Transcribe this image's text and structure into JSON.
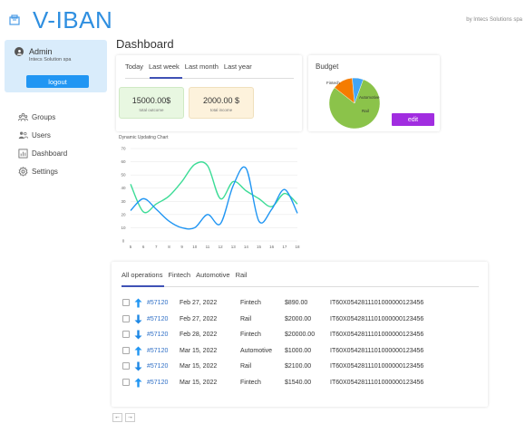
{
  "brand": {
    "name": "V-IBAN",
    "byline": "by Intecs Solutions spa"
  },
  "user": {
    "name": "Admin",
    "company": "Intecs Solution spa",
    "logout_label": "logout"
  },
  "nav": [
    {
      "label": "Groups",
      "icon": "groups-icon"
    },
    {
      "label": "Users",
      "icon": "users-icon"
    },
    {
      "label": "Dashboard",
      "icon": "dashboard-icon"
    },
    {
      "label": "Settings",
      "icon": "gear-icon"
    }
  ],
  "page_title": "Dashboard",
  "period_tabs": [
    "Today",
    "Last week",
    "Last month",
    "Last year"
  ],
  "active_period_tab": "Last week",
  "stats": {
    "outcome": {
      "value": "15000.00$",
      "label": "total outcome"
    },
    "income": {
      "value": "2000.00 $",
      "label": "total income"
    }
  },
  "budget": {
    "title": "Budget",
    "edit_label": "edit",
    "slices": [
      {
        "name": "Fintech",
        "share": 0.8,
        "color": "#8bc34a"
      },
      {
        "name": "Automotive",
        "share": 0.13,
        "color": "#f57c00"
      },
      {
        "name": "Rail",
        "share": 0.07,
        "color": "#42a5f5"
      }
    ]
  },
  "chart_data": {
    "type": "line",
    "title": "Dynamic Updating Chart",
    "x": [
      5,
      6,
      7,
      8,
      9,
      10,
      11,
      12,
      13,
      14,
      15,
      16,
      17,
      18
    ],
    "ylim": [
      0,
      70
    ],
    "yticks": [
      0,
      10,
      20,
      30,
      40,
      50,
      60,
      70
    ],
    "series": [
      {
        "color": "#3ddc97",
        "values": [
          43,
          22,
          28,
          34,
          45,
          58,
          57,
          32,
          45,
          38,
          32,
          26,
          36,
          28
        ]
      },
      {
        "color": "#2196f3",
        "values": [
          23,
          32,
          24,
          15,
          10,
          10,
          20,
          13,
          42,
          55,
          15,
          24,
          39,
          21
        ]
      }
    ]
  },
  "operations": {
    "tabs": [
      "All operations",
      "Fintech",
      "Automotive",
      "Rail"
    ],
    "active_tab": "All operations",
    "rows": [
      {
        "direction": "up",
        "id": "#57120",
        "date": "Feb 27, 2022",
        "category": "Fintech",
        "amount": "$890.00",
        "iban": "IT60X0542811101000000123456"
      },
      {
        "direction": "down",
        "id": "#57120",
        "date": "Feb 27, 2022",
        "category": "Rail",
        "amount": "$2000.00",
        "iban": "IT60X0542811101000000123456"
      },
      {
        "direction": "down",
        "id": "#57120",
        "date": "Feb 28, 2022",
        "category": "Fintech",
        "amount": "$20000.00",
        "iban": "IT60X0542811101000000123456"
      },
      {
        "direction": "up",
        "id": "#57120",
        "date": "Mar 15, 2022",
        "category": "Automotive",
        "amount": "$1000.00",
        "iban": "IT60X0542811101000000123456"
      },
      {
        "direction": "down",
        "id": "#57120",
        "date": "Mar 15, 2022",
        "category": "Rail",
        "amount": "$2100.00",
        "iban": "IT60X0542811101000000123456"
      },
      {
        "direction": "up",
        "id": "#57120",
        "date": "Mar 15, 2022",
        "category": "Fintech",
        "amount": "$1540.00",
        "iban": "IT60X0542811101000000123456"
      }
    ]
  },
  "pager": {
    "prev": "←",
    "next": "→"
  },
  "colors": {
    "brand": "#2f8fe0",
    "accent": "#2196f3",
    "edit": "#a12de0",
    "tab_indicator": "#3f51b5"
  }
}
